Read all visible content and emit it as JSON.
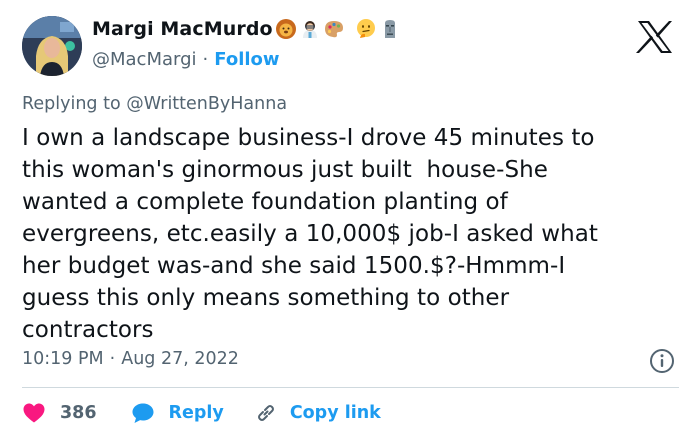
{
  "author": {
    "display_name": "Margi MacMurdo",
    "handle": "@MacMargi",
    "separator": "·",
    "follow_label": "Follow",
    "name_emojis": [
      "lion-face-emoji",
      "woman-scientist-emoji",
      "artist-palette-emoji",
      "thinking-face-emoji",
      "moai-emoji"
    ]
  },
  "reply_context": {
    "prefix": "Replying to ",
    "mention": "@WrittenByHanna"
  },
  "tweet": {
    "text": "I own a landscape business-I drove 45 minutes to\nthis woman's ginormous just built  house-She\nwanted a complete foundation planting of\nevergreens, etc.easily a 10,000$ job-I asked what\nher budget was-and she said 1500.$?-Hmmm-I\nguess this only means something to other\ncontractors",
    "time": "10:19 PM",
    "separator": "·",
    "date": "Aug 27, 2022"
  },
  "actions": {
    "like_count": "386",
    "reply_label": "Reply",
    "copy_link_label": "Copy link"
  },
  "icons": {
    "brand": "x-logo",
    "info": "info-icon",
    "like": "heart-icon",
    "reply": "speech-bubble-icon",
    "copy_link": "link-icon"
  },
  "colors": {
    "text_primary": "#0f1419",
    "text_secondary": "#536471",
    "accent_blue": "#1d9bf0",
    "like_pink": "#f91880",
    "divider": "#cfd9de"
  }
}
